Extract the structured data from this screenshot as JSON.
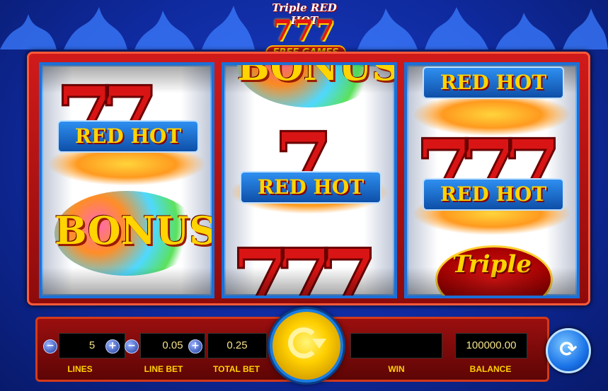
{
  "header": {
    "logo_line1": "Triple RED HOT",
    "logo_777": "777",
    "logo_free": "FREE GAMES"
  },
  "reels": {
    "ribbon_text": "RED HOT",
    "bonus_text": "BONUS",
    "triple_text": "Triple"
  },
  "controls": {
    "lines": {
      "value": "5",
      "label": "LINES"
    },
    "line_bet": {
      "value": "0.05",
      "label": "LINE BET"
    },
    "total_bet": {
      "value": "0.25",
      "label": "TOTAL BET"
    },
    "win": {
      "value": "",
      "label": "WIN"
    },
    "balance": {
      "value": "100000.00",
      "label": "BALANCE"
    },
    "minus": "−",
    "plus": "+"
  },
  "icons": {
    "spin": "spin-icon",
    "autoplay": "autoplay-icon"
  },
  "colors": {
    "accent": "#1a7de0",
    "label": "#ffd200",
    "cabinet": "#d01a1a"
  }
}
